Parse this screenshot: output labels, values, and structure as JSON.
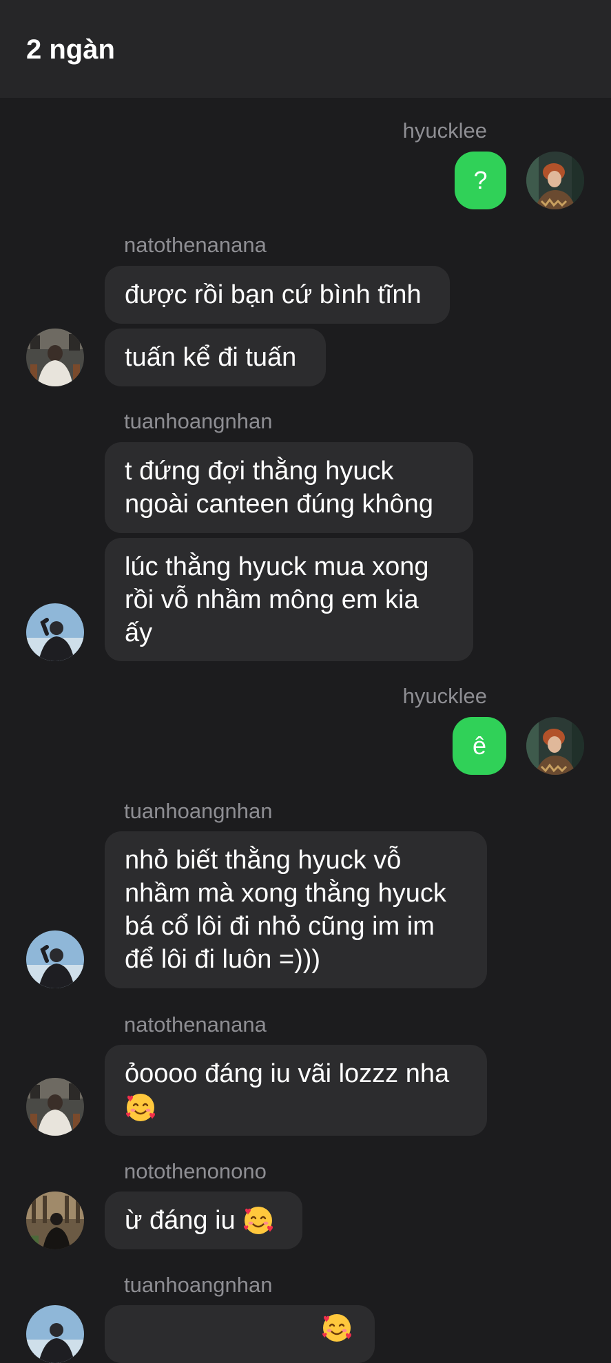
{
  "header": {
    "title": "2 ngàn"
  },
  "messages": [
    {
      "sender": "hyucklee",
      "text": "?"
    },
    {
      "sender": "natothenanana",
      "text_1": "được rồi bạn cứ bình tĩnh",
      "text_2": "tuấn kể đi tuấn"
    },
    {
      "sender": "tuanhoangnhan",
      "text_1a": "t đứng đợi thằng hyuck",
      "text_1b": "ngoài canteen đúng không",
      "text_2a": "lúc thằng hyuck mua xong",
      "text_2b": "rồi vỗ nhầm mông em kia",
      "text_2c": "ấy"
    },
    {
      "sender": "hyucklee",
      "text": "ê"
    },
    {
      "sender": "tuanhoangnhan",
      "line_1": "nhỏ biết thằng hyuck vỗ",
      "line_2": "nhầm mà xong thằng hyuck",
      "line_3": "bá cổ lôi đi nhỏ cũng im im",
      "line_4": "để lôi đi luôn =)))"
    },
    {
      "sender": "natothenanana",
      "line_1": "ỏoooo đáng iu vãi lozzz nha",
      "emoji": "smiling-face-with-hearts"
    },
    {
      "sender": "notothenonono",
      "text": "ừ đáng iu",
      "emoji": "smiling-face-with-hearts"
    },
    {
      "sender": "tuanhoangnhan"
    }
  ],
  "colors": {
    "background": "#1c1c1e",
    "header": "#262628",
    "bubble_incoming": "#2c2c2e",
    "bubble_outgoing": "#30d158",
    "username": "#8e8e93"
  }
}
